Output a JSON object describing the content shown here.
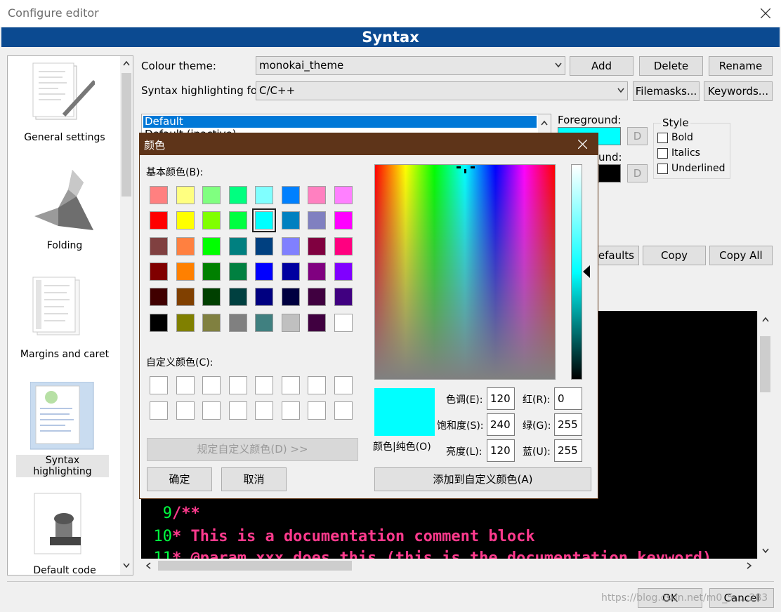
{
  "window": {
    "title": "Configure editor",
    "header": "Syntax"
  },
  "sidebar": {
    "items": [
      {
        "label": "General settings",
        "icon": "document-pen-icon"
      },
      {
        "label": "Folding",
        "icon": "origami-bird-icon"
      },
      {
        "label": "Margins and caret",
        "icon": "document-margins-icon"
      },
      {
        "label": "Syntax highlighting",
        "icon": "syntax-document-icon",
        "selected": true
      },
      {
        "label": "Default code",
        "icon": "stamp-icon"
      }
    ]
  },
  "settings": {
    "colour_theme_label": "Colour theme:",
    "colour_theme_value": "monokai_theme",
    "add_label": "Add",
    "delete_label": "Delete",
    "rename_label": "Rename",
    "syntax_for_label": "Syntax highlighting for:",
    "syntax_for_value": "C/C++",
    "filemasks_label": "Filemasks...",
    "keywords_label": "Keywords...",
    "styles_list": [
      "Default",
      "Default (inactive)"
    ],
    "foreground_label": "Foreground:",
    "foreground_color": "#00ffff",
    "background_label_partial": "und:",
    "background_color": "#000000",
    "d_button": "D",
    "style_group_label": "Style",
    "bold_label": "Bold",
    "italics_label": "Italics",
    "underlined_label": "Underlined",
    "defaults_label": "defaults",
    "copy_label": "Copy",
    "copy_all_label": "Copy All"
  },
  "code_preview": {
    "lines": [
      {
        "num": "9",
        "text": "/**"
      },
      {
        "num": "10",
        "text": " * This is a documentation comment block"
      },
      {
        "num": "11",
        "text": " * @param xxx does this (this is the documentation keyword)"
      }
    ]
  },
  "footer": {
    "ok_label": "OK",
    "cancel_label": "Cancel",
    "watermark": "https://blog.csdn.net/m0_5.....283"
  },
  "color_dialog": {
    "title": "颜色",
    "basic_colors_label": "基本颜色(B):",
    "custom_colors_label": "自定义颜色(C):",
    "define_custom_label": "规定自定义颜色(D) >>",
    "ok_label": "确定",
    "cancel_label": "取消",
    "add_custom_label": "添加到自定义颜色(A)",
    "solid_color_label": "颜色|纯色(O)",
    "hue_label": "色调(E):",
    "hue_value": "120",
    "sat_label": "饱和度(S):",
    "sat_value": "240",
    "lum_label": "亮度(L):",
    "lum_value": "120",
    "red_label": "红(R):",
    "red_value": "0",
    "green_label": "绿(G):",
    "green_value": "255",
    "blue_label": "蓝(U):",
    "blue_value": "255",
    "selected_color": "#00ffff",
    "basic_colors": [
      [
        "#ff8080",
        "#ffff80",
        "#80ff80",
        "#00ff80",
        "#80ffff",
        "#0080ff",
        "#ff80c0",
        "#ff80ff"
      ],
      [
        "#ff0000",
        "#ffff00",
        "#80ff00",
        "#00ff40",
        "#00ffff",
        "#0080c0",
        "#8080c0",
        "#ff00ff"
      ],
      [
        "#804040",
        "#ff8040",
        "#00ff00",
        "#008080",
        "#004080",
        "#8080ff",
        "#800040",
        "#ff0080"
      ],
      [
        "#800000",
        "#ff8000",
        "#008000",
        "#008040",
        "#0000ff",
        "#0000a0",
        "#800080",
        "#8000ff"
      ],
      [
        "#400000",
        "#804000",
        "#004000",
        "#004040",
        "#000080",
        "#000040",
        "#400040",
        "#400080"
      ],
      [
        "#000000",
        "#808000",
        "#808040",
        "#808080",
        "#408080",
        "#c0c0c0",
        "#400040",
        "#ffffff"
      ]
    ]
  }
}
